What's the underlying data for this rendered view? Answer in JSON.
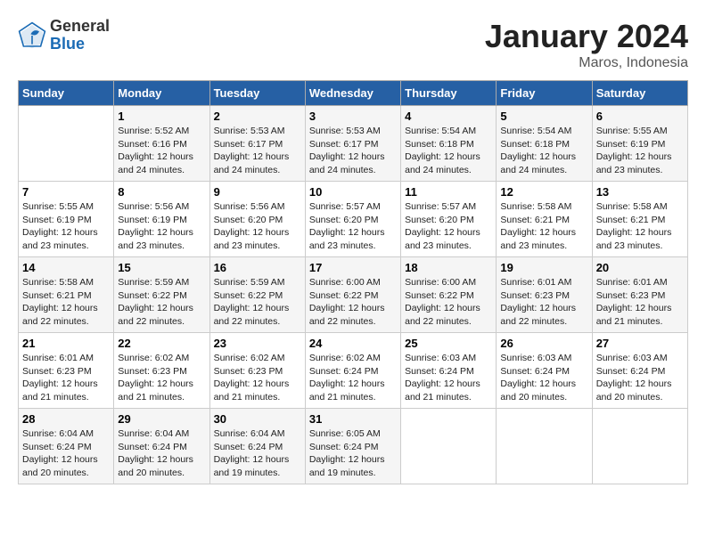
{
  "header": {
    "logo_line1": "General",
    "logo_line2": "Blue",
    "title": "January 2024",
    "subtitle": "Maros, Indonesia"
  },
  "weekdays": [
    "Sunday",
    "Monday",
    "Tuesday",
    "Wednesday",
    "Thursday",
    "Friday",
    "Saturday"
  ],
  "weeks": [
    [
      {
        "num": "",
        "empty": true
      },
      {
        "num": "1",
        "sunrise": "5:52 AM",
        "sunset": "6:16 PM",
        "daylight": "12 hours and 24 minutes."
      },
      {
        "num": "2",
        "sunrise": "5:53 AM",
        "sunset": "6:17 PM",
        "daylight": "12 hours and 24 minutes."
      },
      {
        "num": "3",
        "sunrise": "5:53 AM",
        "sunset": "6:17 PM",
        "daylight": "12 hours and 24 minutes."
      },
      {
        "num": "4",
        "sunrise": "5:54 AM",
        "sunset": "6:18 PM",
        "daylight": "12 hours and 24 minutes."
      },
      {
        "num": "5",
        "sunrise": "5:54 AM",
        "sunset": "6:18 PM",
        "daylight": "12 hours and 24 minutes."
      },
      {
        "num": "6",
        "sunrise": "5:55 AM",
        "sunset": "6:19 PM",
        "daylight": "12 hours and 23 minutes."
      }
    ],
    [
      {
        "num": "7",
        "sunrise": "5:55 AM",
        "sunset": "6:19 PM",
        "daylight": "12 hours and 23 minutes."
      },
      {
        "num": "8",
        "sunrise": "5:56 AM",
        "sunset": "6:19 PM",
        "daylight": "12 hours and 23 minutes."
      },
      {
        "num": "9",
        "sunrise": "5:56 AM",
        "sunset": "6:20 PM",
        "daylight": "12 hours and 23 minutes."
      },
      {
        "num": "10",
        "sunrise": "5:57 AM",
        "sunset": "6:20 PM",
        "daylight": "12 hours and 23 minutes."
      },
      {
        "num": "11",
        "sunrise": "5:57 AM",
        "sunset": "6:20 PM",
        "daylight": "12 hours and 23 minutes."
      },
      {
        "num": "12",
        "sunrise": "5:58 AM",
        "sunset": "6:21 PM",
        "daylight": "12 hours and 23 minutes."
      },
      {
        "num": "13",
        "sunrise": "5:58 AM",
        "sunset": "6:21 PM",
        "daylight": "12 hours and 23 minutes."
      }
    ],
    [
      {
        "num": "14",
        "sunrise": "5:58 AM",
        "sunset": "6:21 PM",
        "daylight": "12 hours and 22 minutes."
      },
      {
        "num": "15",
        "sunrise": "5:59 AM",
        "sunset": "6:22 PM",
        "daylight": "12 hours and 22 minutes."
      },
      {
        "num": "16",
        "sunrise": "5:59 AM",
        "sunset": "6:22 PM",
        "daylight": "12 hours and 22 minutes."
      },
      {
        "num": "17",
        "sunrise": "6:00 AM",
        "sunset": "6:22 PM",
        "daylight": "12 hours and 22 minutes."
      },
      {
        "num": "18",
        "sunrise": "6:00 AM",
        "sunset": "6:22 PM",
        "daylight": "12 hours and 22 minutes."
      },
      {
        "num": "19",
        "sunrise": "6:01 AM",
        "sunset": "6:23 PM",
        "daylight": "12 hours and 22 minutes."
      },
      {
        "num": "20",
        "sunrise": "6:01 AM",
        "sunset": "6:23 PM",
        "daylight": "12 hours and 21 minutes."
      }
    ],
    [
      {
        "num": "21",
        "sunrise": "6:01 AM",
        "sunset": "6:23 PM",
        "daylight": "12 hours and 21 minutes."
      },
      {
        "num": "22",
        "sunrise": "6:02 AM",
        "sunset": "6:23 PM",
        "daylight": "12 hours and 21 minutes."
      },
      {
        "num": "23",
        "sunrise": "6:02 AM",
        "sunset": "6:23 PM",
        "daylight": "12 hours and 21 minutes."
      },
      {
        "num": "24",
        "sunrise": "6:02 AM",
        "sunset": "6:24 PM",
        "daylight": "12 hours and 21 minutes."
      },
      {
        "num": "25",
        "sunrise": "6:03 AM",
        "sunset": "6:24 PM",
        "daylight": "12 hours and 21 minutes."
      },
      {
        "num": "26",
        "sunrise": "6:03 AM",
        "sunset": "6:24 PM",
        "daylight": "12 hours and 20 minutes."
      },
      {
        "num": "27",
        "sunrise": "6:03 AM",
        "sunset": "6:24 PM",
        "daylight": "12 hours and 20 minutes."
      }
    ],
    [
      {
        "num": "28",
        "sunrise": "6:04 AM",
        "sunset": "6:24 PM",
        "daylight": "12 hours and 20 minutes."
      },
      {
        "num": "29",
        "sunrise": "6:04 AM",
        "sunset": "6:24 PM",
        "daylight": "12 hours and 20 minutes."
      },
      {
        "num": "30",
        "sunrise": "6:04 AM",
        "sunset": "6:24 PM",
        "daylight": "12 hours and 19 minutes."
      },
      {
        "num": "31",
        "sunrise": "6:05 AM",
        "sunset": "6:24 PM",
        "daylight": "12 hours and 19 minutes."
      },
      {
        "num": "",
        "empty": true
      },
      {
        "num": "",
        "empty": true
      },
      {
        "num": "",
        "empty": true
      }
    ]
  ],
  "labels": {
    "sunrise_prefix": "Sunrise: ",
    "sunset_prefix": "Sunset: ",
    "daylight_prefix": "Daylight: "
  }
}
